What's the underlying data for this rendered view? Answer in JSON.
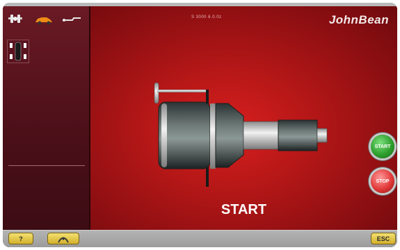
{
  "header": {
    "status_text": "S 3000 6.0.0z",
    "brand": "JohnBean"
  },
  "toolbar": {
    "icons": [
      "wheel-icon",
      "car-icon",
      "wrench-icon"
    ]
  },
  "main": {
    "message": "START"
  },
  "actions": {
    "start_label": "START",
    "stop_label": "STOP"
  },
  "footer": {
    "help_label": "?",
    "home_icon": "home-icon",
    "esc_label": "ESC"
  },
  "colors": {
    "background_red": "#c21a1a",
    "start_green": "#2ea02e",
    "stop_red": "#e23a3a",
    "key_yellow": "#d9b92c"
  }
}
